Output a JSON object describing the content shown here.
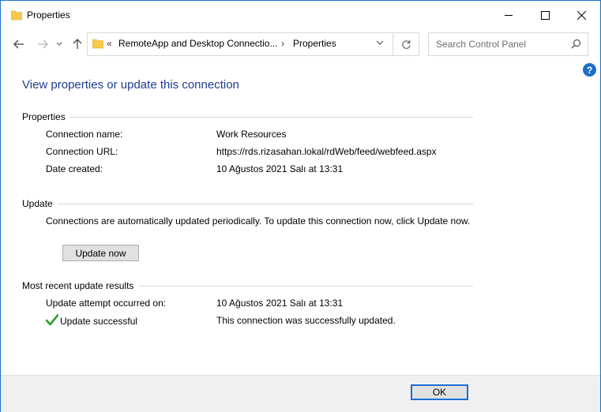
{
  "window": {
    "title": "Properties",
    "minimize_icon": "minimize-icon",
    "maximize_icon": "maximize-icon",
    "close_icon": "close-icon"
  },
  "nav": {
    "back_icon": "back-arrow-icon",
    "forward_icon": "forward-arrow-icon",
    "recent_icon": "chevron-down-icon",
    "up_icon": "up-arrow-icon",
    "address": {
      "separator": "«",
      "crumb1": "RemoteApp and Desktop Connectio...",
      "arrow": "›",
      "crumb2": "Properties"
    },
    "refresh_icon": "refresh-icon",
    "search": {
      "placeholder": "Search Control Panel",
      "value": ""
    }
  },
  "help_label": "?",
  "heading": "View properties or update this connection",
  "properties": {
    "title": "Properties",
    "rows": [
      {
        "label": "Connection name:",
        "value": "Work Resources"
      },
      {
        "label": "Connection URL:",
        "value": "https://rds.rizasahan.lokal/rdWeb/feed/webfeed.aspx"
      },
      {
        "label": "Date created:",
        "value": "10 Ağustos 2021 Salı at 13:31"
      }
    ]
  },
  "update": {
    "title": "Update",
    "text": "Connections are automatically updated periodically.  To update this connection now, click Update now.",
    "button": "Update now"
  },
  "results": {
    "title": "Most recent update results",
    "attempt_label": "Update attempt occurred on:",
    "attempt_value": "10 Ağustos 2021 Salı at 13:31",
    "status_label": "Update successful",
    "status_value": "This connection was successfully updated."
  },
  "footer": {
    "ok": "OK"
  },
  "colors": {
    "accent": "#1e6fd0",
    "heading": "#1e3d8f",
    "success": "#2e9e2e",
    "folder": "#f6c94a"
  }
}
